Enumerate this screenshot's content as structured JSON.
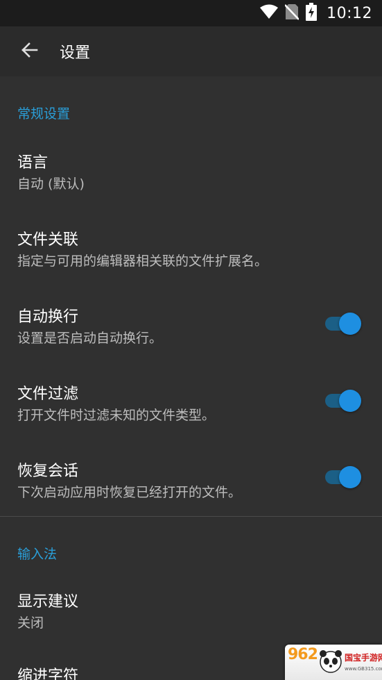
{
  "status_bar": {
    "time": "10:12",
    "icons": [
      "wifi-icon",
      "no-sim-icon",
      "battery-charging-icon"
    ]
  },
  "app_bar": {
    "title": "设置",
    "back_icon": "arrow-left-icon"
  },
  "sections": {
    "general": {
      "header": "常规设置"
    },
    "input": {
      "header": "输入法"
    }
  },
  "items": {
    "language": {
      "title": "语言",
      "summary": "自动 (默认)"
    },
    "file_assoc": {
      "title": "文件关联",
      "summary": "指定与可用的编辑器相关联的文件扩展名。"
    },
    "word_wrap": {
      "title": "自动换行",
      "summary": "设置是否启动自动换行。",
      "enabled": true
    },
    "file_filter": {
      "title": "文件过滤",
      "summary": "打开文件时过滤未知的文件类型。",
      "enabled": true
    },
    "restore_session": {
      "title": "恢复会话",
      "summary": "下次启动应用时恢复已经打开的文件。",
      "enabled": true
    },
    "show_suggestions": {
      "title": "显示建议",
      "summary": "关闭"
    },
    "indent_char": {
      "title": "缩进字符"
    }
  },
  "watermark": {
    "logo": "962",
    "site_name": "国宝手游网",
    "url": "www.GB315.com"
  },
  "colors": {
    "accent": "#2a9ed8",
    "background": "#303030",
    "switch_thumb": "#1e8fe1",
    "switch_track": "#1b5f86"
  }
}
